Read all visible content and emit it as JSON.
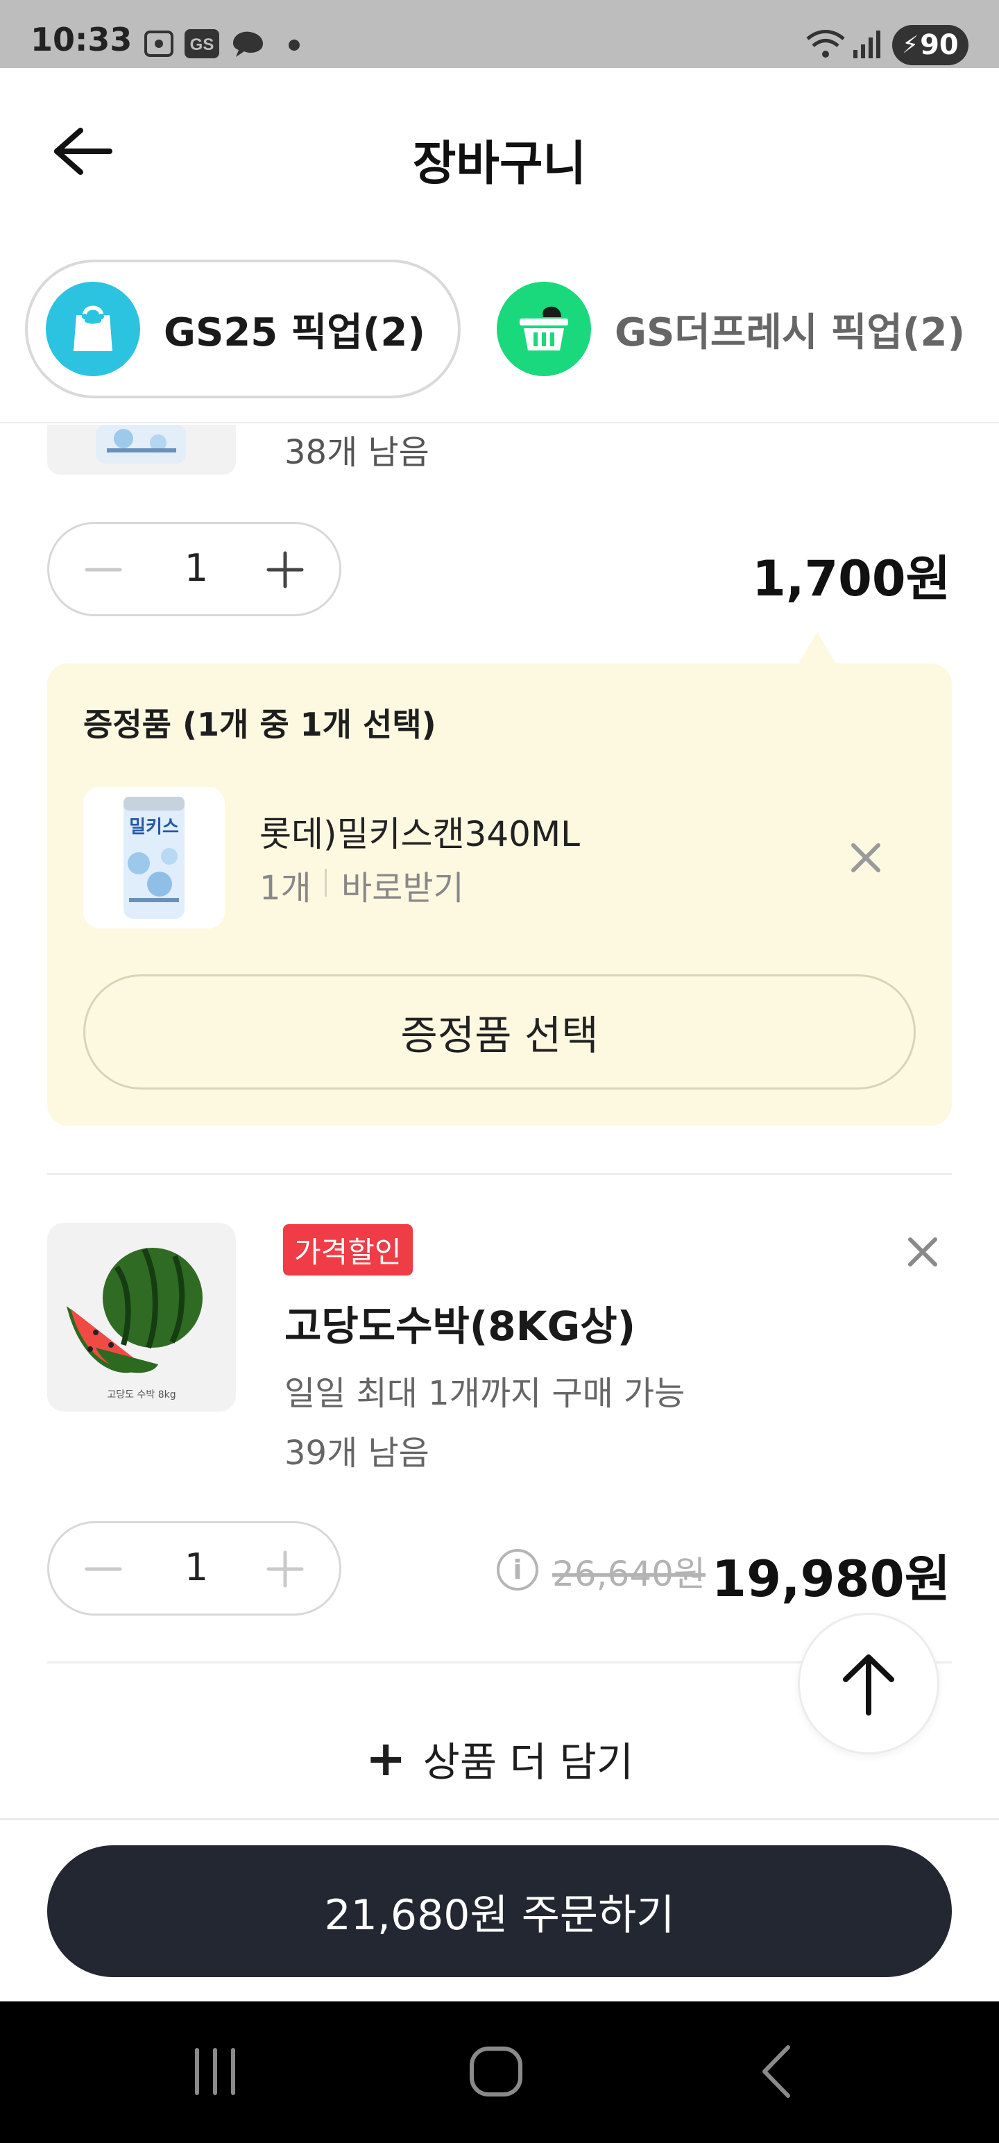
{
  "status_bar": {
    "time": "10:33",
    "battery": "90"
  },
  "header": {
    "title": "장바구니"
  },
  "tabs": [
    {
      "label": "GS25 픽업(2)",
      "icon": "shopping-bag-icon",
      "color": "#2cc3e0"
    },
    {
      "label": "GS더프레시 픽업(2)",
      "icon": "basket-icon",
      "color": "#19d97c"
    }
  ],
  "item1": {
    "stock": "38개 남음",
    "quantity": "1",
    "price": "1,700원"
  },
  "gift": {
    "title": "증정품 (1개 중 1개 선택)",
    "name": "롯데)밀키스캔340ML",
    "qty": "1개",
    "method": "바로받기",
    "select_label": "증정품 선택"
  },
  "item2": {
    "badge": "가격할인",
    "name": "고당도수박(8KG상)",
    "limit": "일일 최대 1개까지 구매 가능",
    "stock": "39개 남음",
    "quantity": "1",
    "original_price": "26,640원",
    "price": "19,980원",
    "image_caption": "고당도 수박 8kg"
  },
  "add_more": {
    "label": "상품 더 담기"
  },
  "order": {
    "label": "21,680원 주문하기"
  },
  "colors": {
    "order_button": "#232731",
    "badge": "#f03c46",
    "gift_bg": "#fdf9e1"
  }
}
